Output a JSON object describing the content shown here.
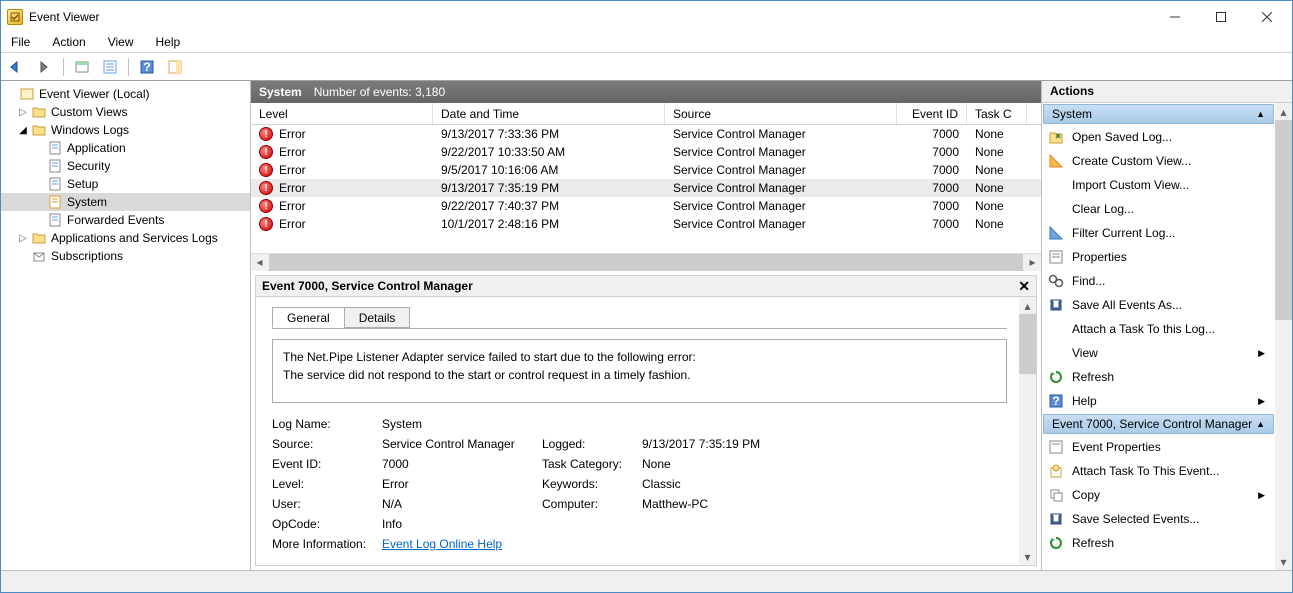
{
  "window": {
    "title": "Event Viewer"
  },
  "menu": {
    "file": "File",
    "action": "Action",
    "view": "View",
    "help": "Help"
  },
  "tree": {
    "root": "Event Viewer (Local)",
    "custom": "Custom Views",
    "winlogs": "Windows Logs",
    "logs": {
      "application": "Application",
      "security": "Security",
      "setup": "Setup",
      "system": "System",
      "forwarded": "Forwarded Events"
    },
    "apps": "Applications and Services Logs",
    "subs": "Subscriptions"
  },
  "list": {
    "name": "System",
    "count_label": "Number of events: 3,180",
    "cols": {
      "level": "Level",
      "date": "Date and Time",
      "source": "Source",
      "id": "Event ID",
      "cat": "Task C"
    },
    "rows": [
      {
        "level": "Error",
        "date": "9/13/2017 7:33:36 PM",
        "source": "Service Control Manager",
        "id": "7000",
        "cat": "None"
      },
      {
        "level": "Error",
        "date": "9/22/2017 10:33:50 AM",
        "source": "Service Control Manager",
        "id": "7000",
        "cat": "None"
      },
      {
        "level": "Error",
        "date": "9/5/2017 10:16:06 AM",
        "source": "Service Control Manager",
        "id": "7000",
        "cat": "None"
      },
      {
        "level": "Error",
        "date": "9/13/2017 7:35:19 PM",
        "source": "Service Control Manager",
        "id": "7000",
        "cat": "None"
      },
      {
        "level": "Error",
        "date": "9/22/2017 7:40:37 PM",
        "source": "Service Control Manager",
        "id": "7000",
        "cat": "None"
      },
      {
        "level": "Error",
        "date": "10/1/2017 2:48:16 PM",
        "source": "Service Control Manager",
        "id": "7000",
        "cat": "None"
      }
    ]
  },
  "detail": {
    "title": "Event 7000, Service Control Manager",
    "tabs": {
      "general": "General",
      "details": "Details"
    },
    "desc_l1": "The Net.Pipe Listener Adapter service failed to start due to the following error:",
    "desc_l2": "The service did not respond to the start or control request in a timely fashion.",
    "p": {
      "logname_k": "Log Name:",
      "logname_v": "System",
      "source_k": "Source:",
      "source_v": "Service Control Manager",
      "logged_k": "Logged:",
      "logged_v": "9/13/2017 7:35:19 PM",
      "id_k": "Event ID:",
      "id_v": "7000",
      "taskcat_k": "Task Category:",
      "taskcat_v": "None",
      "level_k": "Level:",
      "level_v": "Error",
      "keywords_k": "Keywords:",
      "keywords_v": "Classic",
      "user_k": "User:",
      "user_v": "N/A",
      "computer_k": "Computer:",
      "computer_v": "Matthew-PC",
      "opcode_k": "OpCode:",
      "opcode_v": "Info",
      "more_k": "More Information:",
      "more_v": "Event Log Online Help"
    }
  },
  "actions": {
    "header": "Actions",
    "group1": "System",
    "items1": [
      "Open Saved Log...",
      "Create Custom View...",
      "Import Custom View...",
      "Clear Log...",
      "Filter Current Log...",
      "Properties",
      "Find...",
      "Save All Events As...",
      "Attach a Task To this Log...",
      "View",
      "Refresh",
      "Help"
    ],
    "group2": "Event 7000, Service Control Manager",
    "items2": [
      "Event Properties",
      "Attach Task To This Event...",
      "Copy",
      "Save Selected Events...",
      "Refresh"
    ]
  }
}
